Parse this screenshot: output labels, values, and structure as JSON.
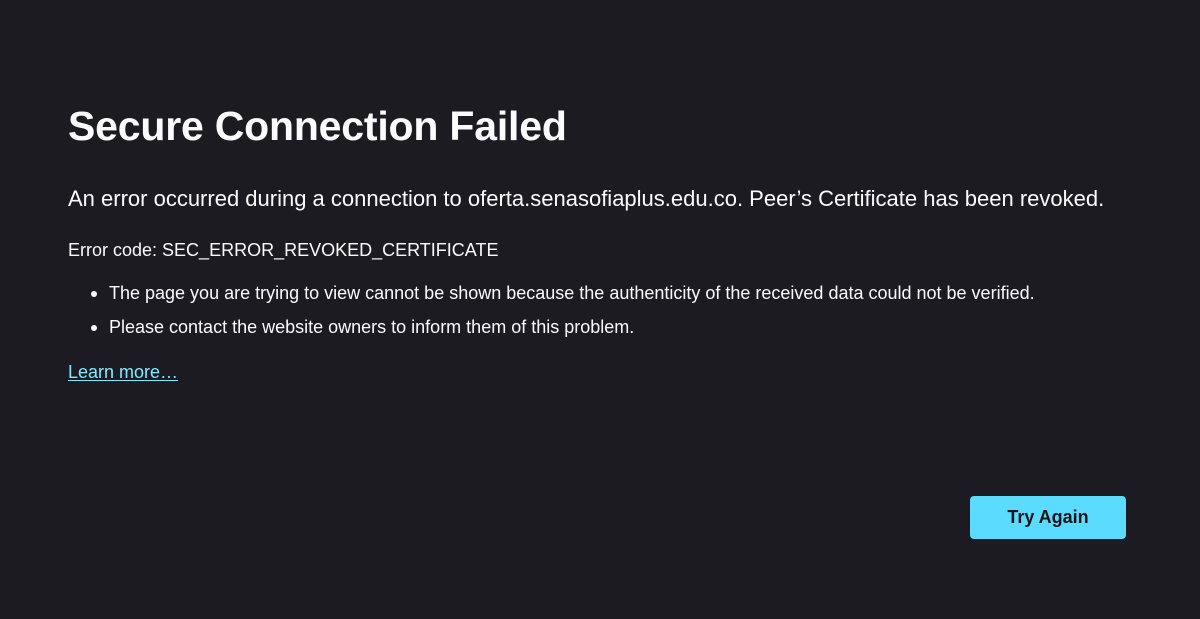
{
  "error_page": {
    "title": "Secure Connection Failed",
    "description": "An error occurred during a connection to oferta.senasofiaplus.edu.co. Peer’s Certificate has been revoked.",
    "error_code_label": "Error code:",
    "error_code_value": "SEC_ERROR_REVOKED_CERTIFICATE",
    "bullets": [
      "The page you are trying to view cannot be shown because the authenticity of the received data could not be verified.",
      "Please contact the website owners to inform them of this problem."
    ],
    "learn_more": "Learn more…",
    "try_again": "Try Again"
  },
  "colors": {
    "background": "#1c1b22",
    "text": "#fbfbfe",
    "link": "#80ebff",
    "button": "#5bdcff",
    "button_text": "#15141a"
  }
}
